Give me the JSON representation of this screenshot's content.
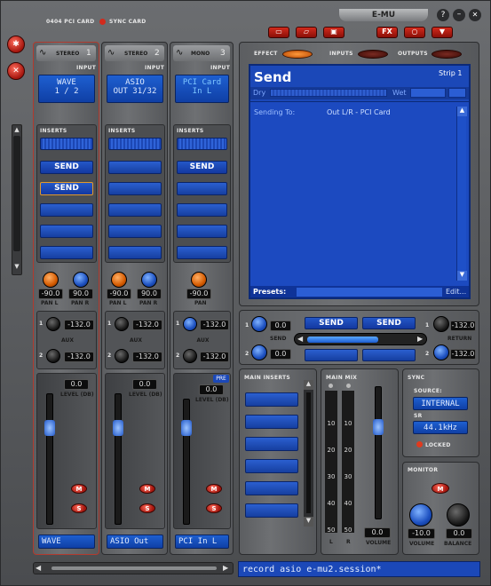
{
  "header": {
    "card_label": "0404 PCI CARD",
    "sync_label": "SYNC CARD",
    "brand": "E-MU"
  },
  "toolbar": {
    "fx_label": "FX"
  },
  "strips": [
    {
      "type": "STEREO",
      "num": "1",
      "input_label": "INPUT",
      "input_line1": "WAVE",
      "input_line2": "1 / 2",
      "inserts_label": "INSERTS",
      "insert1": "SEND",
      "insert2": "SEND",
      "pan_l": "-90.0",
      "pan_r": "90.0",
      "pan_l_label": "PAN L",
      "pan_r_label": "PAN R",
      "aux1": "-132.0",
      "aux2": "-132.0",
      "aux_label": "AUX",
      "level": "0.0",
      "level_label": "LEVEL (DB)",
      "m": "M",
      "s": "S",
      "name": "WAVE"
    },
    {
      "type": "STEREO",
      "num": "2",
      "input_label": "INPUT",
      "input_line1": "ASIO",
      "input_line2": "OUT 31/32",
      "inserts_label": "INSERTS",
      "pan_l": "-90.0",
      "pan_r": "90.0",
      "pan_l_label": "PAN L",
      "pan_r_label": "PAN R",
      "aux1": "-132.0",
      "aux2": "-132.0",
      "aux_label": "AUX",
      "level": "0.0",
      "level_label": "LEVEL (DB)",
      "m": "M",
      "s": "S",
      "name": "ASIO Out"
    },
    {
      "type": "MONO",
      "num": "3",
      "input_label": "INPUT",
      "input_line1": "PCI Card",
      "input_line2": "In L",
      "inserts_label": "INSERTS",
      "insert1": "SEND",
      "pan": "-90.0",
      "pan_label": "PAN",
      "aux1": "-132.0",
      "aux2": "-132.0",
      "aux_label": "AUX",
      "pre": "PRE",
      "level": "0.0",
      "level_label": "LEVEL (DB)",
      "m": "M",
      "s": "S",
      "name": "PCI In L"
    }
  ],
  "tabs": {
    "effect": "EFFECT",
    "inputs": "INPUTS",
    "outputs": "OUTPUTS"
  },
  "effect_panel": {
    "title": "Send",
    "strip": "Strip 1",
    "dry": "Dry",
    "wet": "Wet",
    "sending_to_label": "Sending To:",
    "sending_to_value": "Out L/R - PCI Card",
    "presets_label": "Presets:",
    "edit_label": "Edit..."
  },
  "send_section": {
    "aux1": "0.0",
    "aux2": "0.0",
    "send_label": "SEND",
    "send_btn1": "SEND",
    "send_btn2": "SEND",
    "return_label": "RETURN",
    "ret1": "-132.0",
    "ret2": "-132.0",
    "n1": "1",
    "n2": "2"
  },
  "main_inserts": {
    "label": "MAIN INSERTS"
  },
  "main_mix": {
    "label": "MAIN MIX",
    "scale": [
      "10",
      "20",
      "30",
      "40",
      "50"
    ],
    "scale2": [
      "10",
      "20",
      "30",
      "40",
      "50"
    ],
    "l": "L",
    "r": "R",
    "volume": "0.0",
    "volume_label": "VOLUME"
  },
  "sync": {
    "label": "SYNC",
    "source_label": "SOURCE:",
    "source": "INTERNAL",
    "sr_label": "SR",
    "sr": "44.1kHz",
    "locked": "LOCKED"
  },
  "monitor": {
    "label": "MONITOR",
    "m": "M",
    "volume": "-10.0",
    "balance": "0.0",
    "volume_label": "VOLUME",
    "balance_label": "BALANCE"
  },
  "status": {
    "session": "record asio e-mu2.session*"
  },
  "colors": {
    "accent_blue": "#1b48b8",
    "red": "#c0281a",
    "bg": "#5c5e61"
  }
}
